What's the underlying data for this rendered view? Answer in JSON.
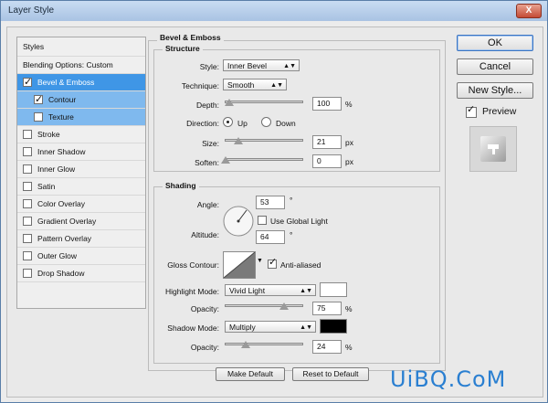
{
  "window": {
    "title": "Layer Style",
    "close_label": "X"
  },
  "left_panel": {
    "header": "Styles",
    "blending": "Blending Options: Custom",
    "items": [
      {
        "label": "Bevel & Emboss",
        "checked": true
      },
      {
        "label": "Contour",
        "checked": true
      },
      {
        "label": "Texture",
        "checked": false
      },
      {
        "label": "Stroke",
        "checked": false
      },
      {
        "label": "Inner Shadow",
        "checked": false
      },
      {
        "label": "Inner Glow",
        "checked": false
      },
      {
        "label": "Satin",
        "checked": false
      },
      {
        "label": "Color Overlay",
        "checked": false
      },
      {
        "label": "Gradient Overlay",
        "checked": false
      },
      {
        "label": "Pattern Overlay",
        "checked": false
      },
      {
        "label": "Outer Glow",
        "checked": false
      },
      {
        "label": "Drop Shadow",
        "checked": false
      }
    ]
  },
  "bevel": {
    "title": "Bevel & Emboss",
    "structure": {
      "title": "Structure",
      "style_label": "Style:",
      "style_value": "Inner Bevel",
      "technique_label": "Technique:",
      "technique_value": "Smooth",
      "depth_label": "Depth:",
      "depth_value": "100",
      "depth_unit": "%",
      "direction_label": "Direction:",
      "dir_up": "Up",
      "dir_down": "Down",
      "size_label": "Size:",
      "size_value": "21",
      "size_unit": "px",
      "soften_label": "Soften:",
      "soften_value": "0",
      "soften_unit": "px"
    },
    "shading": {
      "title": "Shading",
      "angle_label": "Angle:",
      "angle_value": "53",
      "angle_unit": "°",
      "global_light_label": "Use Global Light",
      "altitude_label": "Altitude:",
      "altitude_value": "64",
      "altitude_unit": "°",
      "gloss_label": "Gloss Contour:",
      "anti_aliased_label": "Anti-aliased",
      "highlight_mode_label": "Highlight Mode:",
      "highlight_mode_value": "Vivid Light",
      "highlight_color": "#ffffff",
      "highlight_opacity_label": "Opacity:",
      "highlight_opacity_value": "75",
      "highlight_opacity_unit": "%",
      "shadow_mode_label": "Shadow Mode:",
      "shadow_mode_value": "Multiply",
      "shadow_color": "#000000",
      "shadow_opacity_label": "Opacity:",
      "shadow_opacity_value": "24",
      "shadow_opacity_unit": "%"
    }
  },
  "buttons": {
    "ok": "OK",
    "cancel": "Cancel",
    "new_style": "New Style...",
    "preview": "Preview",
    "make_default": "Make Default",
    "reset_default": "Reset to Default"
  },
  "watermark": "UiBQ.CoM"
}
